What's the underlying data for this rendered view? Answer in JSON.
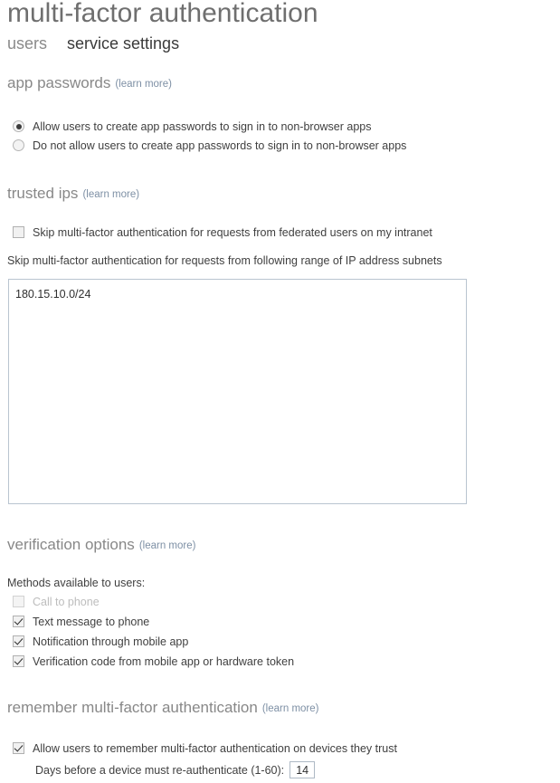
{
  "header": {
    "title": "multi-factor authentication",
    "tabs": [
      {
        "label": "users",
        "active": false
      },
      {
        "label": "service settings",
        "active": true
      }
    ]
  },
  "learn_more_label": "(learn more)",
  "sections": {
    "app_passwords": {
      "heading": "app passwords",
      "options": [
        {
          "label": "Allow users to create app passwords to sign in to non-browser apps",
          "selected": true
        },
        {
          "label": "Do not allow users to create app passwords to sign in to non-browser apps",
          "selected": false
        }
      ]
    },
    "trusted_ips": {
      "heading": "trusted ips",
      "federated_checkbox": {
        "label": "Skip multi-factor authentication for requests from federated users on my intranet",
        "checked": false
      },
      "subnets_label": "Skip multi-factor authentication for requests from following range of IP address subnets",
      "subnets_value": "180.15.10.0/24"
    },
    "verification_options": {
      "heading": "verification options",
      "methods_label": "Methods available to users:",
      "methods": [
        {
          "label": "Call to phone",
          "checked": false,
          "disabled": true
        },
        {
          "label": "Text message to phone",
          "checked": true,
          "disabled": false
        },
        {
          "label": "Notification through mobile app",
          "checked": true,
          "disabled": false
        },
        {
          "label": "Verification code from mobile app or hardware token",
          "checked": true,
          "disabled": false
        }
      ]
    },
    "remember_mfa": {
      "heading": "remember multi-factor authentication",
      "allow_remember": {
        "label": "Allow users to remember multi-factor authentication on devices they trust",
        "checked": true
      },
      "days_label": "Days before a device must re-authenticate (1-60):",
      "days_value": "14"
    }
  },
  "colors": {
    "title": "#6f6f6f",
    "section_heading": "#888888",
    "learn_more_link": "#7e90a5",
    "body_text": "#3f3f3f",
    "disabled_text": "#bdbdbd",
    "input_border": "#b9c4d0"
  }
}
